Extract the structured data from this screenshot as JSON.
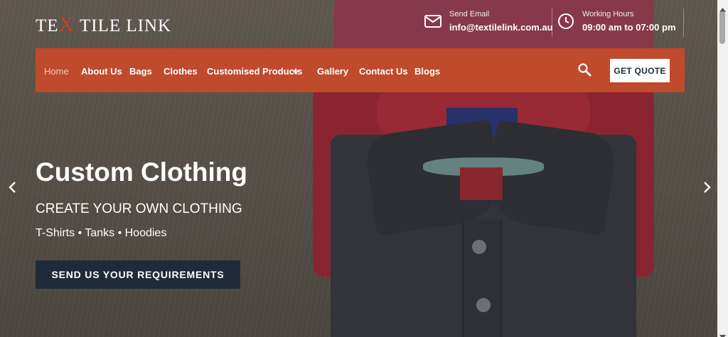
{
  "logo": {
    "pre": "TE",
    "x": "X",
    "post": " TILE LINK"
  },
  "contact": {
    "email": {
      "label": "Send Email",
      "value": "info@textilelink.com.au",
      "icon": "envelope-icon"
    },
    "hours": {
      "label": "Working Hours",
      "value": "09:00 am to 07:00 pm",
      "icon": "clock-icon"
    }
  },
  "nav": {
    "items": [
      {
        "label": "Home",
        "active": true
      },
      {
        "label": "About Us"
      },
      {
        "label": "Bags"
      },
      {
        "label": "Clothes"
      },
      {
        "label": "Customised Products",
        "has_dropdown": true
      },
      {
        "label": "Gallery"
      },
      {
        "label": "Contact Us"
      },
      {
        "label": "Blogs"
      }
    ],
    "quote_label": "GET QUOTE"
  },
  "hero": {
    "title": "Custom Clothing",
    "subtitle": "CREATE YOUR OWN CLOTHING",
    "items": "T-Shirts • Tanks • Hoodies",
    "cta": "SEND US YOUR REQUIREMENTS"
  },
  "colors": {
    "brand": "#c04a2c",
    "navy": "#1f2b3b",
    "white": "#ffffff"
  }
}
